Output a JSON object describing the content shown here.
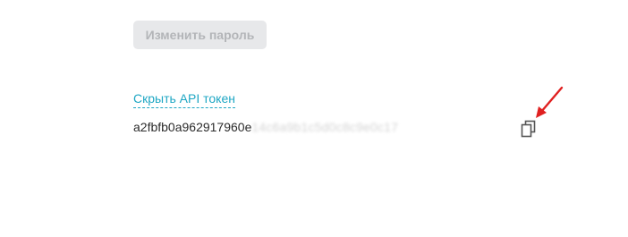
{
  "settings": {
    "change_password_label": "Изменить пароль",
    "hide_api_token_label": "Скрыть API токен",
    "api_token_visible": "a2fbfb0a962917960e",
    "api_token_blurred": "14c6a9b1c5d0c8c9e0c17"
  },
  "icons": {
    "copy": "copy-icon",
    "annotation_arrow": "red-arrow"
  },
  "colors": {
    "link": "#1fa7c4",
    "button_bg": "#e7e8ea",
    "button_text": "#b3b5b8",
    "arrow": "#e02020"
  }
}
